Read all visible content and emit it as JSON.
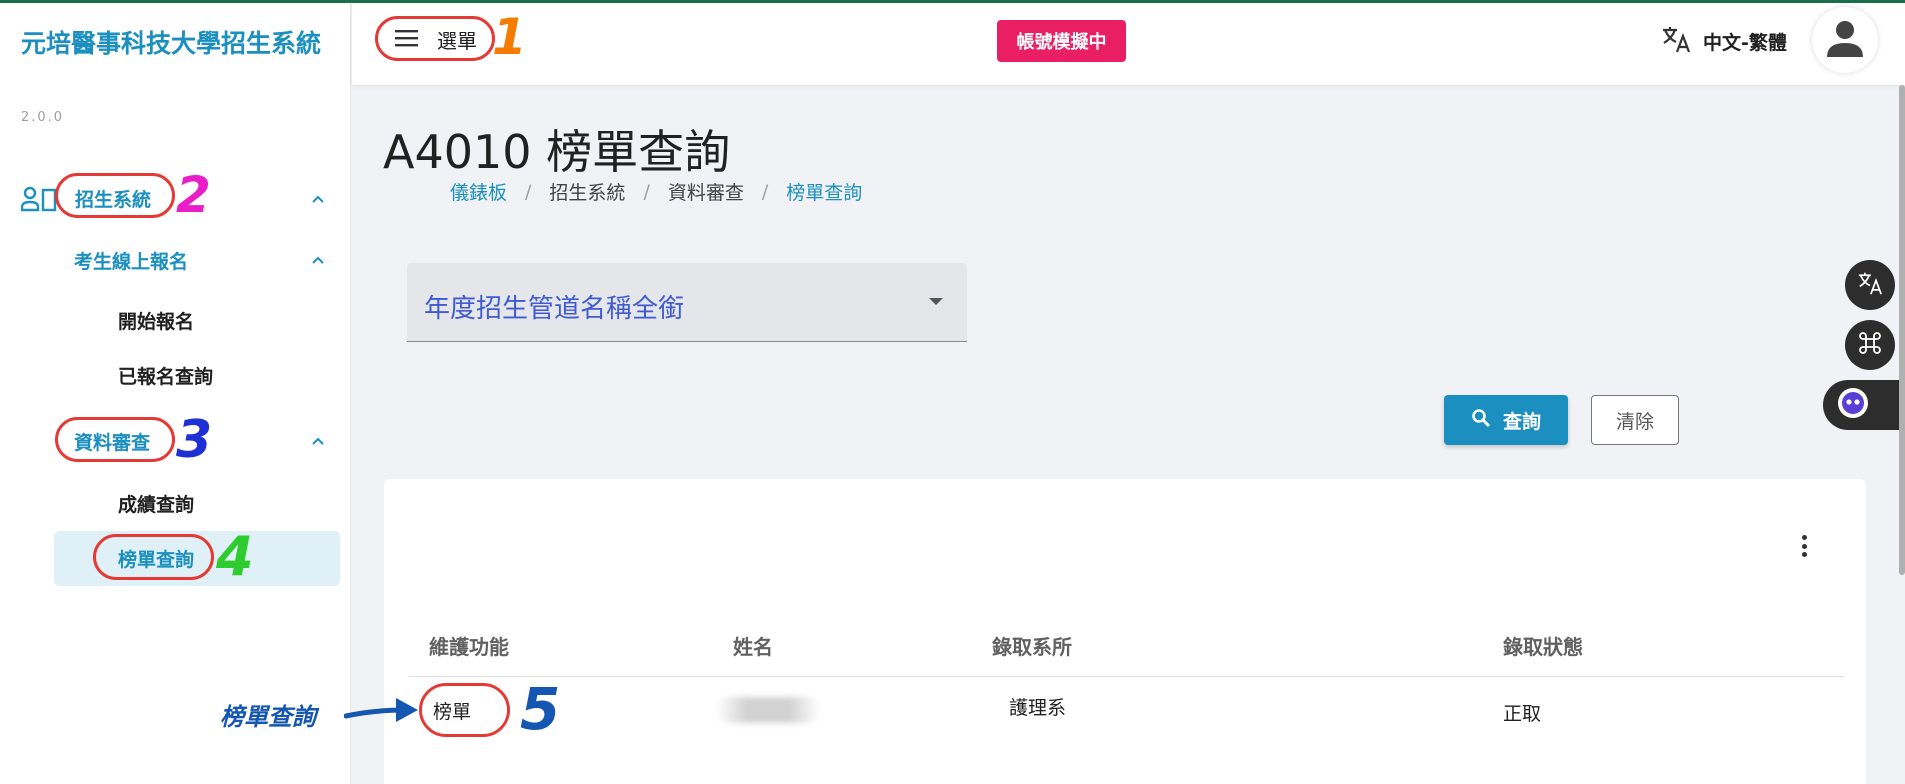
{
  "app": {
    "system_title": "元培醫事科技大學招生系統",
    "version": "2.0.0"
  },
  "topbar": {
    "menu_label": "選單",
    "impersonation_badge": "帳號模擬中",
    "language_label": "中文-繁體",
    "menu_icon": "hamburger-icon",
    "language_icon": "translate-icon",
    "avatar_icon": "account-icon"
  },
  "sidebar": {
    "group": {
      "label": "招生系統",
      "icon": "people-icon",
      "sections": [
        {
          "label": "考生線上報名",
          "items": [
            "開始報名",
            "已報名查詢"
          ]
        },
        {
          "label": "資料審查",
          "items": [
            "成績查詢",
            "榜單查詢"
          ]
        }
      ]
    }
  },
  "page": {
    "title": "A4010 榜單查詢",
    "breadcrumb": [
      "儀錶板",
      "招生系統",
      "資料審查",
      "榜單查詢"
    ]
  },
  "filter": {
    "select_value": "年度招生管道名稱全銜",
    "search_label": "查詢",
    "clear_label": "清除"
  },
  "table": {
    "headers": [
      "維護功能",
      "姓名",
      "錄取系所",
      "錄取狀態"
    ],
    "rows": [
      {
        "action": "榜單",
        "department": "護理系",
        "status": "正取"
      }
    ]
  },
  "annotations": {
    "numbers": [
      "1",
      "2",
      "3",
      "4",
      "5"
    ],
    "arrow_label": "榜單查詢",
    "colors": {
      "oval": "#e53935",
      "n1": "#f57c00",
      "n2": "#e91ec8",
      "n3": "#1e2fd6",
      "n4": "#2ecc2e",
      "n5": "#1557b0"
    }
  },
  "colors": {
    "accent": "#1a8fc0",
    "badge": "#e91e63",
    "select_text": "#3f5bd1"
  }
}
